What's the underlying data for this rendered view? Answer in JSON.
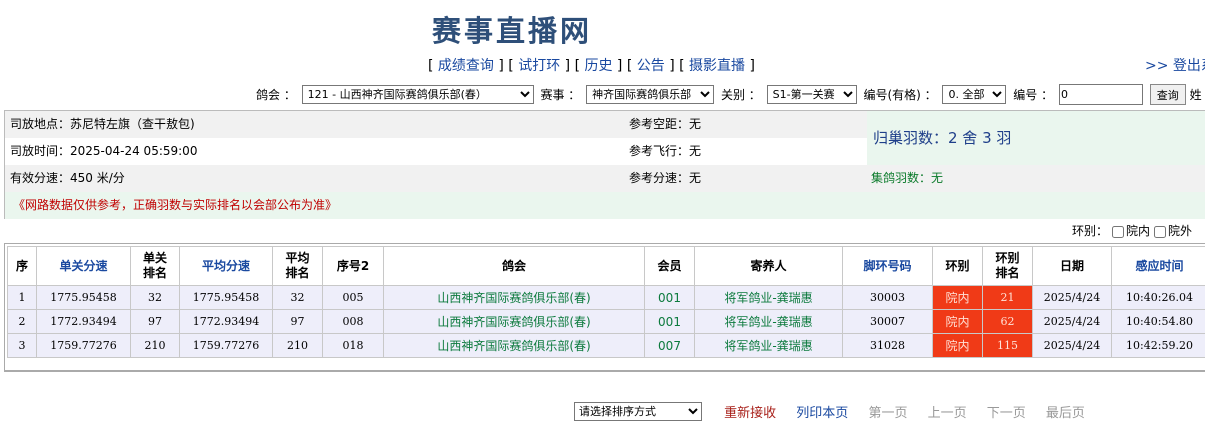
{
  "header": {
    "title": "赛事直播网",
    "nav": [
      "成绩查询",
      "试打环",
      "历史",
      "公告",
      "摄影直播"
    ],
    "login": ">> 登出系"
  },
  "filters": {
    "club_label": "鸽会 ：",
    "club_value": "121 - 山西神齐国际赛鸽俱乐部(春）",
    "race_label": "赛事 ：",
    "race_value": "神齐国际赛鸽俱乐部",
    "stage_label": "关别 ：",
    "stage_value": "S1-第一关赛",
    "num_label": "编号(有格) ：",
    "num_value": "0. 全部",
    "id_label": "编号 ：",
    "id_value": "0",
    "search_button": "查询",
    "trailing_label": "姓"
  },
  "info": {
    "release_place": "司放地点：苏尼特左旗（查干敖包)",
    "release_time": "司放时间：2025-04-24 05:59:00",
    "valid_speed": "有效分速：450 米/分",
    "ref_distance": "参考空距：无",
    "ref_flight": "参考飞行：无",
    "ref_speed": "参考分速：无",
    "returned": "归巢羽数：2 舍 3 羽",
    "collected": "集鸽羽数：无",
    "notice": "《网路数据仅供参考，正确羽数与实际排名以会部公布为准》"
  },
  "ring_filter": {
    "label": "环别：",
    "inside": "院内",
    "outside": "院外"
  },
  "table": {
    "columns": [
      "序",
      "单关分速",
      "单关\n排名",
      "平均分速",
      "平均\n排名",
      "序号2",
      "鸽会",
      "会员",
      "寄养人",
      "脚环号码",
      "环别",
      "环别\n排名",
      "日期",
      "感应时间"
    ],
    "rows": [
      [
        "1",
        "1775.95458",
        "32",
        "1775.95458",
        "32",
        "005",
        "山西神齐国际赛鸽俱乐部(春)",
        "001",
        "将军鸽业-龚瑞惠",
        "30003",
        "院内",
        "21",
        "2025/4/24",
        "10:40:26.04"
      ],
      [
        "2",
        "1772.93494",
        "97",
        "1772.93494",
        "97",
        "008",
        "山西神齐国际赛鸽俱乐部(春)",
        "001",
        "将军鸽业-龚瑞惠",
        "30007",
        "院内",
        "62",
        "2025/4/24",
        "10:40:54.80"
      ],
      [
        "3",
        "1759.77276",
        "210",
        "1759.77276",
        "210",
        "018",
        "山西神齐国际赛鸽俱乐部(春)",
        "007",
        "将军鸽业-龚瑞惠",
        "31028",
        "院内",
        "115",
        "2025/4/24",
        "10:42:59.20"
      ]
    ]
  },
  "pager": {
    "sort_placeholder": "请选择排序方式",
    "reload": "重新接收",
    "print": "列印本页",
    "first": "第一页",
    "prev": "上一页",
    "next": "下一页",
    "last": "最后页"
  },
  "colors": {
    "title": "#2e4f79",
    "link": "#1a49a0",
    "green": "#0c7a3d",
    "highlight_red": "#f03a17",
    "notice_red": "#c00000",
    "row_bg": "#eeeefa"
  }
}
